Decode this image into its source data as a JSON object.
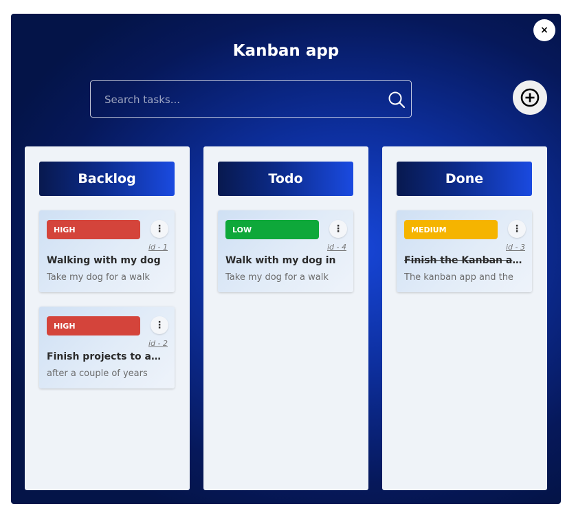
{
  "app": {
    "title": "Kanban app",
    "close_label": "×"
  },
  "search": {
    "placeholder": "Search tasks..."
  },
  "colors": {
    "high": "#d4443b",
    "low": "#0ea83a",
    "medium": "#f5b400"
  },
  "columns": [
    {
      "title": "Backlog",
      "cards": [
        {
          "priority": "HIGH",
          "id": "id - 1",
          "title": "Walking with my dog",
          "desc": "Take my dog for a walk"
        },
        {
          "priority": "HIGH",
          "id": "id - 2",
          "title": "Finish projects to apply",
          "desc": "after a couple of years"
        }
      ]
    },
    {
      "title": "Todo",
      "cards": [
        {
          "priority": "LOW",
          "id": "id - 4",
          "title": "Walk with my dog in",
          "desc": "Take my dog for a walk"
        }
      ]
    },
    {
      "title": "Done",
      "cards": [
        {
          "priority": "MEDIUM",
          "id": "id - 3",
          "title": "Finish the Kanban app",
          "desc": "The kanban app and the"
        }
      ]
    }
  ]
}
